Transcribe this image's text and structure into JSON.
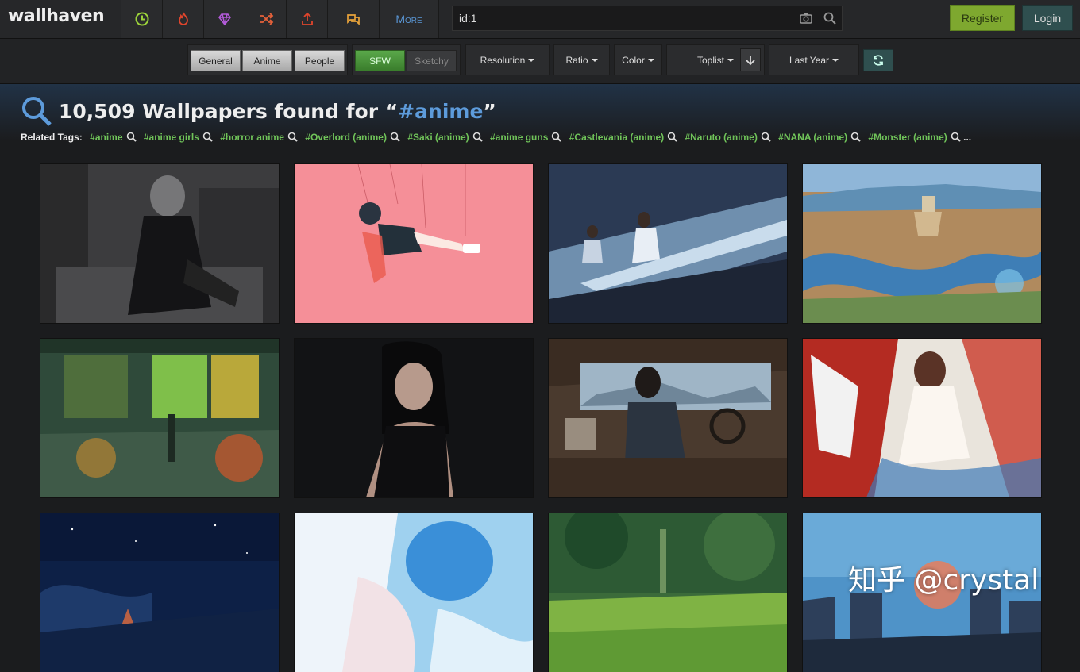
{
  "app": {
    "logo": "wallhaven"
  },
  "nav": {
    "icons": [
      "clock-icon",
      "fire-icon",
      "diamond-icon",
      "shuffle-icon",
      "upload-icon",
      "chat-icon"
    ],
    "more_label": "More"
  },
  "search": {
    "value": "id:1",
    "placeholder": ""
  },
  "auth": {
    "register_label": "Register",
    "login_label": "Login"
  },
  "filters": {
    "categories": [
      "General",
      "Anime",
      "People"
    ],
    "purity": [
      "SFW",
      "Sketchy"
    ],
    "resolution": "Resolution",
    "ratio": "Ratio",
    "color": "Color",
    "sorting": "Toplist",
    "range": "Last Year"
  },
  "results": {
    "count": "10,509",
    "prefix": "Wallpapers found for “",
    "query": "#anime",
    "suffix": "”"
  },
  "related": {
    "label": "Related Tags:",
    "tags": [
      "#anime",
      "#anime girls",
      "#horror anime",
      "#Overlord (anime)",
      "#Saki (anime)",
      "#anime guns",
      "#Castlevania (anime)",
      "#Naruto (anime)",
      "#NANA (anime)",
      "#Monster (anime)"
    ],
    "ellipsis": "..."
  },
  "watermark": "知乎 @crystal",
  "colors": {
    "accent": "#5d9bdb",
    "tag": "#70c45a",
    "register": "#7ea82f",
    "login": "#2f4f4f"
  }
}
